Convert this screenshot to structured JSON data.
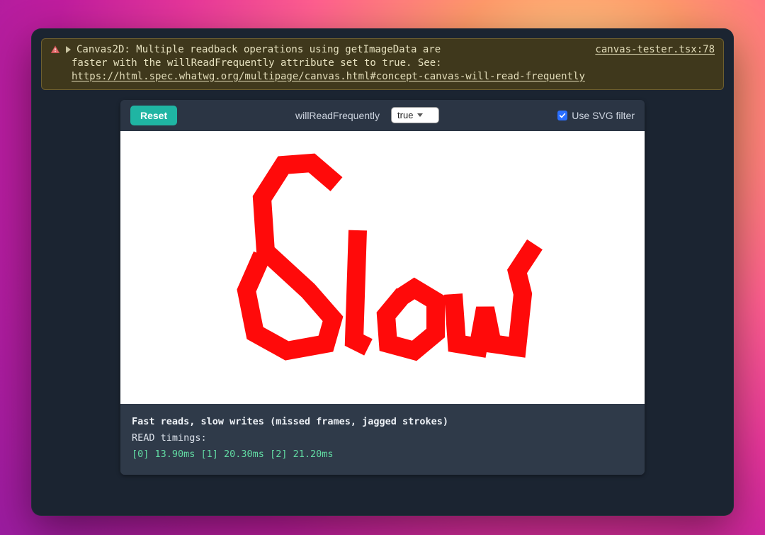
{
  "console": {
    "warning_line1": "Canvas2D: Multiple readback operations using getImageData are",
    "warning_line2": "faster with the willReadFrequently attribute set to true. See:",
    "link_text": "https://html.spec.whatwg.org/multipage/canvas.html#concept-canvas-will-read-frequently",
    "source_ref": "canvas-tester.tsx:78"
  },
  "toolbar": {
    "reset_label": "Reset",
    "wrf_label": "willReadFrequently",
    "wrf_value": "true",
    "svg_filter_label": "Use SVG filter",
    "svg_filter_checked": true
  },
  "canvas": {
    "drawing_text": "Slow",
    "stroke_color": "#ff0a0a"
  },
  "output": {
    "title": "Fast reads, slow writes (missed frames, jagged strokes)",
    "timings_label": "READ timings:",
    "samples": "[0] 13.90ms [1] 20.30ms [2] 21.20ms"
  }
}
